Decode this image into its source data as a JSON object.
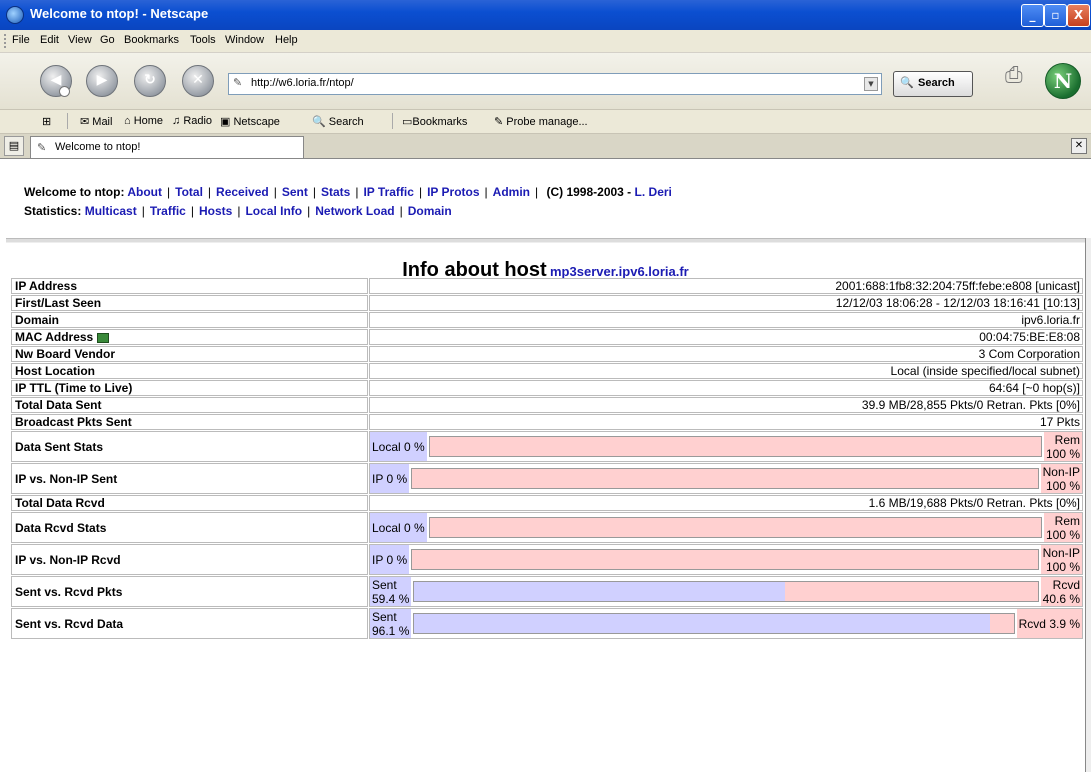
{
  "window": {
    "title": "Welcome to ntop! - Netscape",
    "min": "_",
    "max": "▫",
    "close": "X"
  },
  "menu": [
    "File",
    "Edit",
    "View",
    "Go",
    "Bookmarks",
    "Tools",
    "Window",
    "Help"
  ],
  "nav": {
    "url": "http://w6.loria.fr/ntop/",
    "search_label": "Search"
  },
  "personal_toolbar": [
    "Mail",
    "Home",
    "Radio",
    "Netscape",
    "Search",
    "Bookmarks",
    "Probe manage..."
  ],
  "tab": {
    "title": "Welcome to ntop!"
  },
  "links": {
    "welcome": "Welcome to ntop:",
    "row1": [
      "About",
      "Total",
      "Received",
      "Sent",
      "Stats",
      "IP Traffic",
      "IP Protos",
      "Admin"
    ],
    "copyright": "(C) 1998-2003 -",
    "author": "L. Deri",
    "statistics": "Statistics:",
    "row2": [
      "Multicast",
      "Traffic",
      "Hosts",
      "Local Info",
      "Network Load",
      "Domain"
    ]
  },
  "page": {
    "heading": "Info about host",
    "host": "mp3server.ipv6.loria.fr"
  },
  "rows": [
    {
      "label": "IP Address",
      "value": "2001:688:1fb8:32:204:75ff:febe:e808   [unicast]"
    },
    {
      "label": "First/Last Seen",
      "value": "12/12/03 18:06:28  -  12/12/03 18:16:41 [10:13]"
    },
    {
      "label": "Domain",
      "value": "ipv6.loria.fr"
    },
    {
      "label": "MAC Address",
      "value": "00:04:75:BE:E8:08"
    },
    {
      "label": "Nw Board Vendor",
      "value": "3 Com Corporation"
    },
    {
      "label": "Host Location",
      "value": "Local (inside specified/local subnet)"
    },
    {
      "label": "IP TTL (Time to Live)",
      "value": "64:64 [~0 hop(s)]"
    },
    {
      "label": "Total Data Sent",
      "value": "39.9 MB/28,855 Pkts/0 Retran. Pkts [0%]"
    },
    {
      "label": "Broadcast Pkts Sent",
      "value": "17 Pkts"
    }
  ],
  "bars": {
    "data_sent": {
      "label": "Data Sent Stats",
      "left": "Local 0 %",
      "right": "Rem\n100 %",
      "fraction_left": 0.0
    },
    "ip_sent": {
      "label": "IP vs. Non-IP Sent",
      "left": "IP 0 %",
      "right": "Non-IP\n100 %",
      "fraction_left": 0.0
    },
    "total_rcvd": {
      "label": "Total Data Rcvd",
      "value": "1.6 MB/19,688 Pkts/0 Retran. Pkts [0%]"
    },
    "data_rcvd": {
      "label": "Data Rcvd Stats",
      "left": "Local 0 %",
      "right": "Rem\n100 %",
      "fraction_left": 0.0
    },
    "ip_rcvd": {
      "label": "IP vs. Non-IP Rcvd",
      "left": "IP 0 %",
      "right": "Non-IP\n100 %",
      "fraction_left": 0.0
    },
    "pkts": {
      "label": "Sent vs. Rcvd Pkts",
      "left": "Sent\n59.4 %",
      "right": "Rcvd\n40.6 %",
      "fraction_left": 0.594
    },
    "data": {
      "label": "Sent vs. Rcvd Data",
      "left": "Sent\n96.1 %",
      "right": "Rcvd 3.9 %",
      "fraction_left": 0.961
    }
  }
}
